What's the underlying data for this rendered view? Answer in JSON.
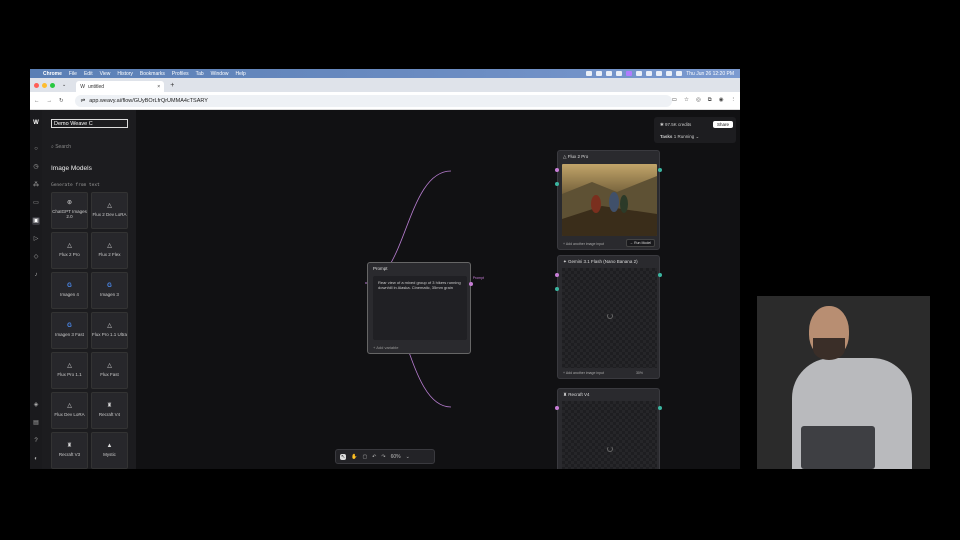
{
  "menubar": {
    "apple": "",
    "items": [
      "Chrome",
      "File",
      "Edit",
      "View",
      "History",
      "Bookmarks",
      "Profiles",
      "Tab",
      "Window",
      "Help"
    ],
    "clock": "Thu Jun 26  12:20 PM"
  },
  "browser": {
    "tab_title": "untitled",
    "tab_close": "×",
    "new_tab": "+",
    "url": "app.weavy.ai/flow/GUyBOrLfrQrUMMA4cTSARY"
  },
  "app": {
    "project_name": "Demo Weave C",
    "search_placeholder": "Search",
    "panel_title": "Image Models",
    "section_label": "Generate from text",
    "models": [
      {
        "label": "ChatGPT Images 2.0",
        "icon": "⊛"
      },
      {
        "label": "Flux 2 Dev LoRA",
        "icon": "△"
      },
      {
        "label": "Flux 2 Pro",
        "icon": "△"
      },
      {
        "label": "Flux 2 Flex",
        "icon": "△"
      },
      {
        "label": "Imagen 4",
        "icon": "G"
      },
      {
        "label": "Imagen 3",
        "icon": "G"
      },
      {
        "label": "Imagen 3 Fast",
        "icon": "G"
      },
      {
        "label": "Flux Pro 1.1 Ultra",
        "icon": "△"
      },
      {
        "label": "Flux Pro 1.1",
        "icon": "△"
      },
      {
        "label": "Flux Fast",
        "icon": "△"
      },
      {
        "label": "Flux Dev LoRA",
        "icon": "△"
      },
      {
        "label": "Recraft V4",
        "icon": "♜"
      },
      {
        "label": "Recraft V3",
        "icon": "♜"
      },
      {
        "label": "Mystic",
        "icon": "▲"
      }
    ],
    "credits": "97.5K credits",
    "share": "Share",
    "tasks_label": "Tasks",
    "tasks_status": "1 Running"
  },
  "nodes": {
    "prompt": {
      "title": "Prompt",
      "text": "Rear view of a mixed group of 3 hikers running downhill in Alaska. Cinematic, 35mm grain",
      "add_variable": "+ Add variable",
      "out_label": "Prompt"
    },
    "flux": {
      "title": "Flux 2 Pro",
      "add_image_input": "+ Add another image input",
      "run_button": "→ Run Model"
    },
    "gemini": {
      "title": "Gemini 3.1 Flash (Nano Banana 2)",
      "add_image_input": "+ Add another image input",
      "progress": "30%"
    },
    "recraft": {
      "title": "Recraft V4"
    }
  },
  "bottombar": {
    "zoom": "60%"
  }
}
